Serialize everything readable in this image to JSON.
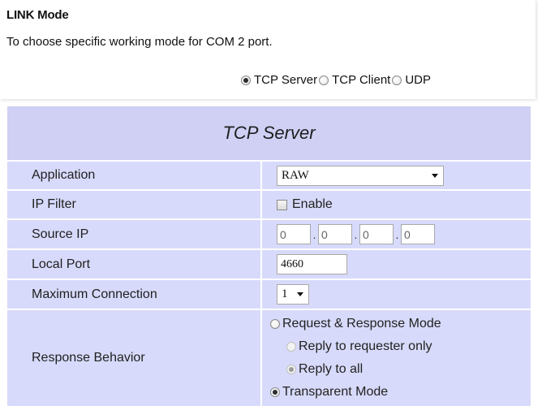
{
  "link": {
    "title": "LINK Mode",
    "description": "To choose specific working mode for COM 2 port.",
    "modes": [
      {
        "label": "TCP Server",
        "checked": true
      },
      {
        "label": "TCP Client",
        "checked": false
      },
      {
        "label": "UDP",
        "checked": false
      }
    ]
  },
  "table": {
    "title": "TCP Server",
    "application": {
      "label": "Application",
      "value": "RAW"
    },
    "ip_filter": {
      "label": "IP Filter",
      "checkbox_label": "Enable",
      "checked": false
    },
    "source_ip": {
      "label": "Source IP",
      "octets": [
        "0",
        "0",
        "0",
        "0"
      ]
    },
    "local_port": {
      "label": "Local Port",
      "value": "4660"
    },
    "max_connection": {
      "label": "Maximum Connection",
      "value": "1"
    },
    "response": {
      "label": "Response Behavior",
      "request_response": "Request & Response Mode",
      "reply_requester": "Reply to requester only",
      "reply_all": "Reply to all",
      "transparent": "Transparent Mode"
    }
  },
  "colors": {
    "row_bg": "#d7dafa",
    "header_bg": "#cfd0f4"
  }
}
